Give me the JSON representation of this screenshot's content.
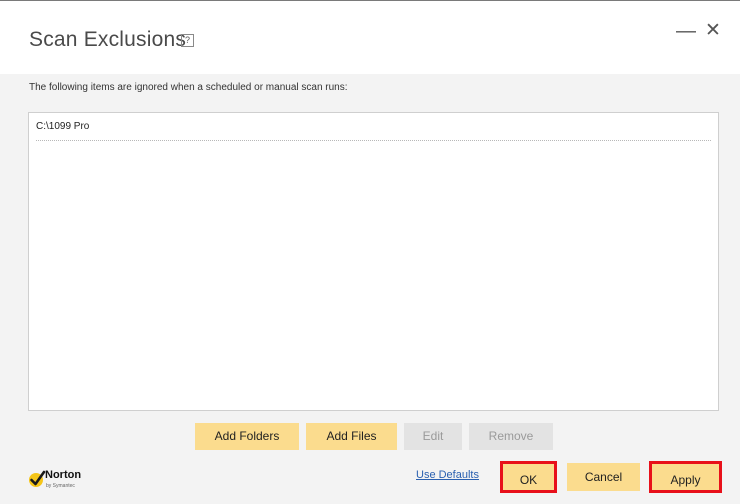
{
  "dialog": {
    "title": "Scan Exclusions",
    "help_icon": "?",
    "minimize_icon": "—",
    "close_icon": "✕"
  },
  "description": "The following items are ignored when a scheduled or manual scan runs:",
  "exclusions": [
    "C:\\1099 Pro"
  ],
  "buttons": {
    "add_folders": "Add Folders",
    "add_files": "Add Files",
    "edit": "Edit",
    "remove": "Remove",
    "use_defaults": "Use Defaults",
    "ok": "OK",
    "cancel": "Cancel",
    "apply": "Apply"
  },
  "brand": {
    "name": "Norton",
    "sub": "by Symantec",
    "check_color": "#f5c518"
  },
  "colors": {
    "button_bg": "#fbdc8e",
    "disabled_bg": "#e3e3e3",
    "highlight": "#e8101a",
    "link": "#2a60b0"
  }
}
